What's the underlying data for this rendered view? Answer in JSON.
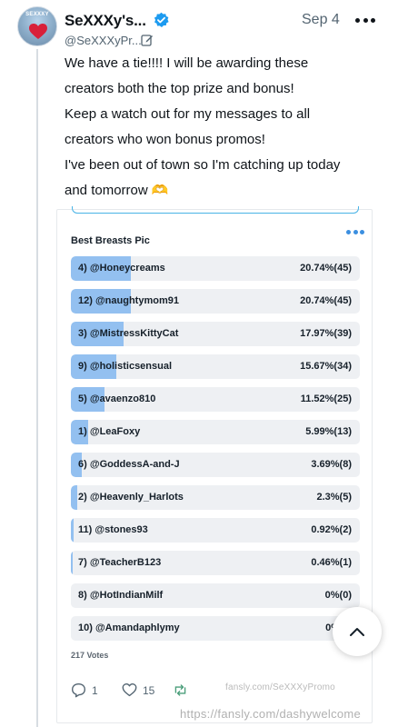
{
  "tweet": {
    "display_name": "SeXXXy's...",
    "handle": "@SeXXXyPr...",
    "date": "Sep 4",
    "text_lines": [
      "We have a tie!!!! I will be awarding these",
      "creators both the top prize and bonus!",
      "Keep a watch out for my messages to all",
      "creators who won bonus promos!",
      "I've been out of town so I'm catching up today",
      "and tomorrow 🫶"
    ],
    "icons": {
      "verified": "verified-badge-icon",
      "edited": "edit-icon",
      "more": "more-icon"
    }
  },
  "poll": {
    "title": "Best Breasts Pic",
    "accent_color": "#93c0f0",
    "options": [
      {
        "label": "4) @Honeycreams",
        "result": "20.74%(45)",
        "percent": 20.74
      },
      {
        "label": "12) @naughtymom91",
        "result": "20.74%(45)",
        "percent": 20.74
      },
      {
        "label": "3) @MistressKittyCat",
        "result": "17.97%(39)",
        "percent": 17.97
      },
      {
        "label": "9) @holisticsensual",
        "result": "15.67%(34)",
        "percent": 15.67
      },
      {
        "label": "5) @avaenzo810",
        "result": "11.52%(25)",
        "percent": 11.52
      },
      {
        "label": "1) @LeaFoxy",
        "result": "5.99%(13)",
        "percent": 5.99
      },
      {
        "label": "6) @GoddessA-and-J",
        "result": "3.69%(8)",
        "percent": 3.69
      },
      {
        "label": "2) @Heavenly_Harlots",
        "result": "2.3%(5)",
        "percent": 2.3
      },
      {
        "label": "11) @stones93",
        "result": "0.92%(2)",
        "percent": 0.92
      },
      {
        "label": "7) @TeacherB123",
        "result": "0.46%(1)",
        "percent": 0.46
      },
      {
        "label": "8) @HotIndianMilf",
        "result": "0%(0)",
        "percent": 0
      },
      {
        "label": "10) @Amandaphlymy",
        "result": "0%",
        "percent": 0
      }
    ],
    "votes": "217 Votes",
    "actions": {
      "comments": "1",
      "likes": "15"
    }
  },
  "watermark": "https://fansly.com/dashywelcome",
  "watermark_small": "fansly.com/SeXXXyPromo"
}
